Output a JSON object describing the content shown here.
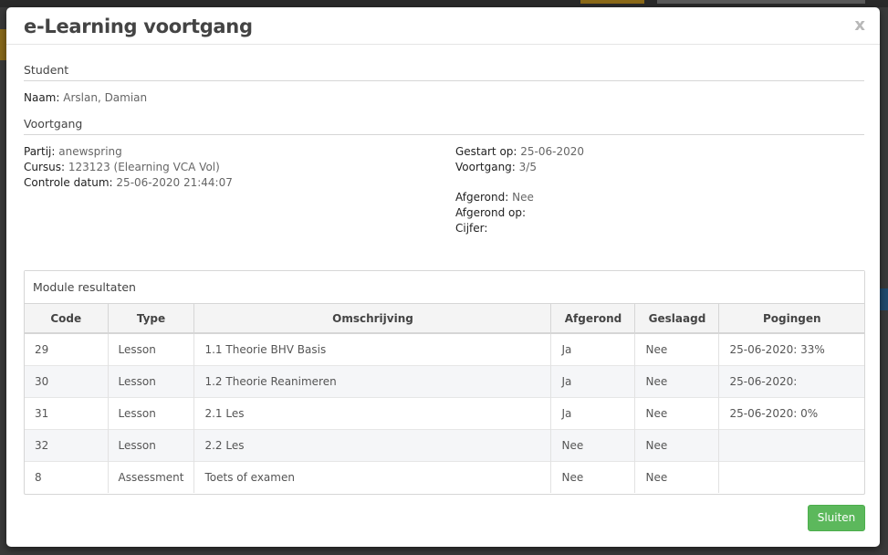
{
  "modal": {
    "title": "e-Learning voortgang",
    "close_label": "x"
  },
  "student": {
    "section": "Student",
    "name_label": "Naam:",
    "name_value": "Arslan, Damian"
  },
  "progress": {
    "section": "Voortgang",
    "partij_label": "Partij:",
    "partij_value": "anewspring",
    "cursus_label": "Cursus:",
    "cursus_value": "123123 (Elearning VCA Vol)",
    "controle_label": "Controle datum:",
    "controle_value": "25-06-2020 21:44:07",
    "gestart_label": "Gestart op:",
    "gestart_value": "25-06-2020",
    "voortgang_label": "Voortgang:",
    "voortgang_value": "3/5",
    "afgerond_label": "Afgerond:",
    "afgerond_value": "Nee",
    "afgerond_op_label": "Afgerond op:",
    "afgerond_op_value": "",
    "cijfer_label": "Cijfer:",
    "cijfer_value": ""
  },
  "results": {
    "title": "Module resultaten",
    "columns": [
      "Code",
      "Type",
      "Omschrijving",
      "Afgerond",
      "Geslaagd",
      "Pogingen"
    ],
    "rows": [
      [
        "29",
        "Lesson",
        "1.1 Theorie BHV Basis",
        "Ja",
        "Nee",
        "25-06-2020: 33%"
      ],
      [
        "30",
        "Lesson",
        "1.2 Theorie Reanimeren",
        "Ja",
        "Nee",
        "25-06-2020:"
      ],
      [
        "31",
        "Lesson",
        "2.1 Les",
        "Ja",
        "Nee",
        "25-06-2020: 0%"
      ],
      [
        "32",
        "Lesson",
        "2.2 Les",
        "Nee",
        "Nee",
        ""
      ],
      [
        "8",
        "Assessment",
        "Toets of examen",
        "Nee",
        "Nee",
        ""
      ]
    ]
  },
  "footer": {
    "close_button": "Sluiten"
  },
  "colors": {
    "primary_success": "#5cb85c",
    "header_bg": "#f4f4f4",
    "stripe": "#f5f6f8"
  }
}
